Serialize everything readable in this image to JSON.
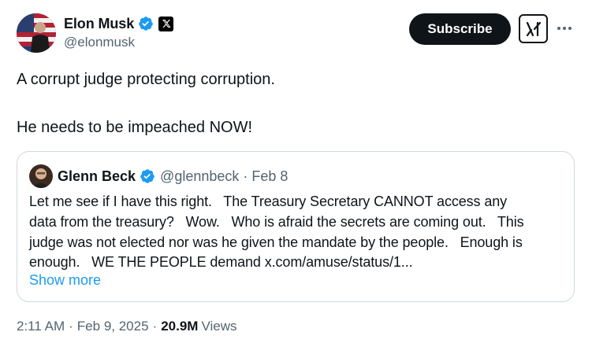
{
  "author": {
    "display_name": "Elon Musk",
    "handle": "@elonmusk",
    "verified": true,
    "affiliate_badge": "x-logo"
  },
  "actions": {
    "subscribe_label": "Subscribe",
    "grok_icon": "grok-icon",
    "more_icon": "more-icon"
  },
  "tweet": {
    "line1": "A corrupt judge protecting corruption.",
    "line2": "He needs to be impeached NOW!"
  },
  "quote": {
    "display_name": "Glenn Beck",
    "handle": "@glennbeck",
    "separator": "·",
    "date": "Feb 8",
    "lines": [
      "Let me see if I have this right.   The Treasury Secretary CANNOT access any",
      "data from the treasury?   Wow.   Who is afraid the secrets are coming out.   This",
      "judge was not elected nor was he given the mandate by the people.   Enough is",
      "enough.   WE THE PEOPLE demand x.com/amuse/status/1..."
    ],
    "show_more": "Show more"
  },
  "meta": {
    "time": "2:11 AM",
    "separator": "·",
    "date": "Feb 9, 2025",
    "views_count": "20.9M",
    "views_label": "Views"
  },
  "colors": {
    "verified_blue": "#1d9bf0",
    "text_primary": "#0f1419",
    "text_secondary": "#536471",
    "border": "#cfd9de",
    "link": "#1d9bf0"
  }
}
